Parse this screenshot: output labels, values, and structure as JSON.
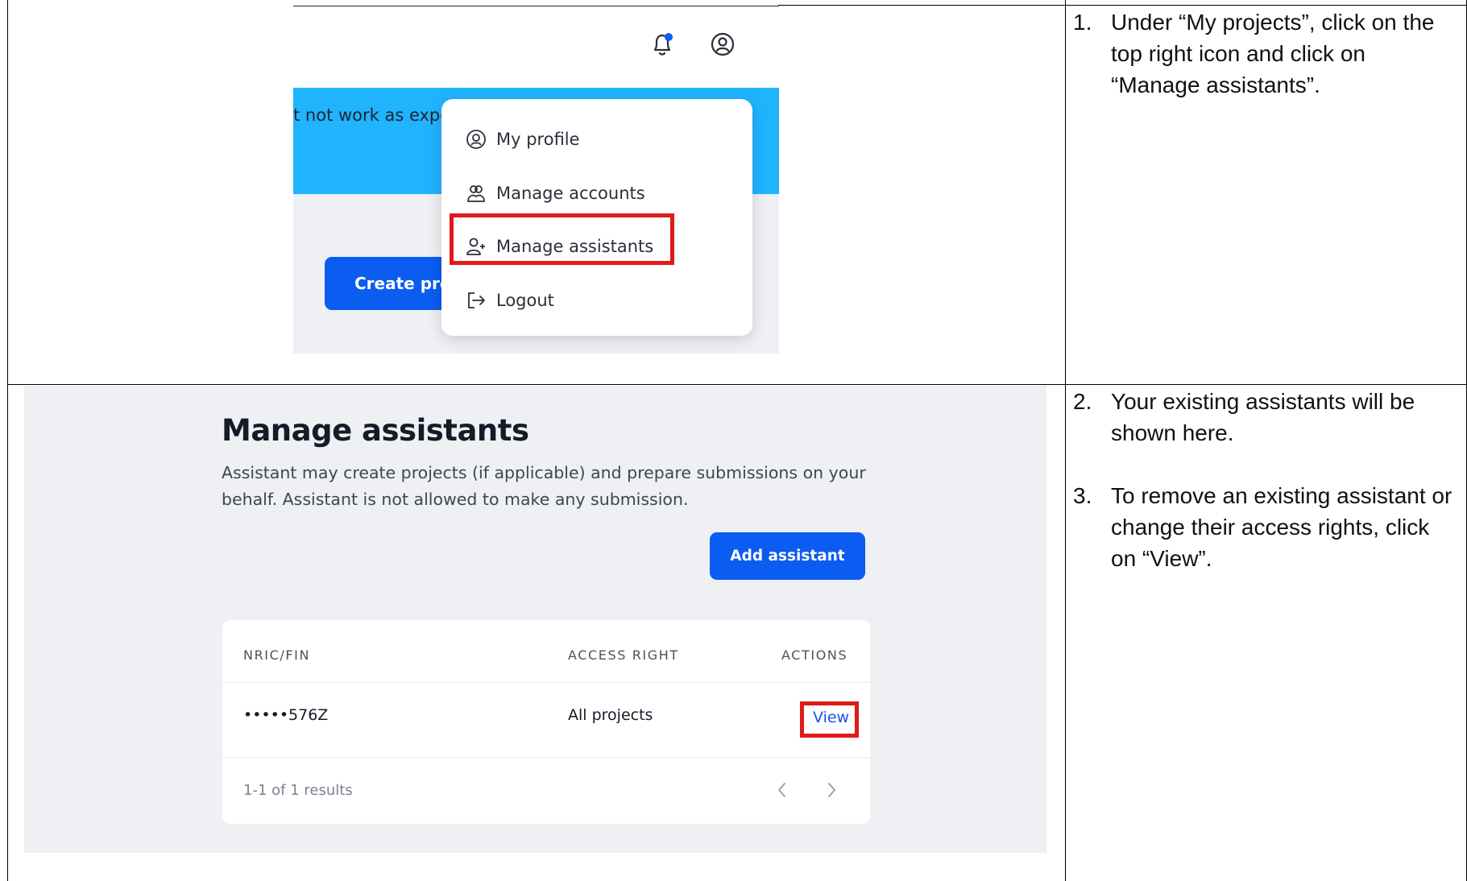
{
  "screen1": {
    "banner_text": "t not work as expe",
    "create_button_label": "Create proj",
    "menu": {
      "items": [
        {
          "label": "My profile",
          "icon": "user-circle-icon"
        },
        {
          "label": "Manage accounts",
          "icon": "users-icon"
        },
        {
          "label": "Manage assistants",
          "icon": "user-plus-icon"
        },
        {
          "label": "Logout",
          "icon": "logout-icon"
        }
      ]
    },
    "icons": [
      "bell-icon",
      "user-circle-icon"
    ]
  },
  "screen2": {
    "title": "Manage assistants",
    "description": "Assistant may create projects (if applicable) and prepare submissions on your behalf. Assistant is not allowed to make any submission.",
    "add_button_label": "Add assistant",
    "table": {
      "columns": [
        "NRIC/FIN",
        "ACCESS RIGHT",
        "ACTIONS"
      ],
      "rows": [
        {
          "nric": "•••••576Z",
          "access": "All projects",
          "action": "View"
        }
      ],
      "results_text": "1-1 of 1 results"
    }
  },
  "instructions": [
    {
      "number": "1.",
      "text": "Under “My projects”, click on the top right icon and click on “Manage assistants”."
    },
    {
      "number": "2.",
      "text": "Your existing assistants will be shown here."
    },
    {
      "number": "3.",
      "text": "To remove an existing assistant or change their access rights, click on “View”."
    }
  ],
  "colors": {
    "primary": "#0b5cf0",
    "banner": "#20b4ff",
    "highlight": "#e01919",
    "panel_bg": "#eef0f4"
  }
}
